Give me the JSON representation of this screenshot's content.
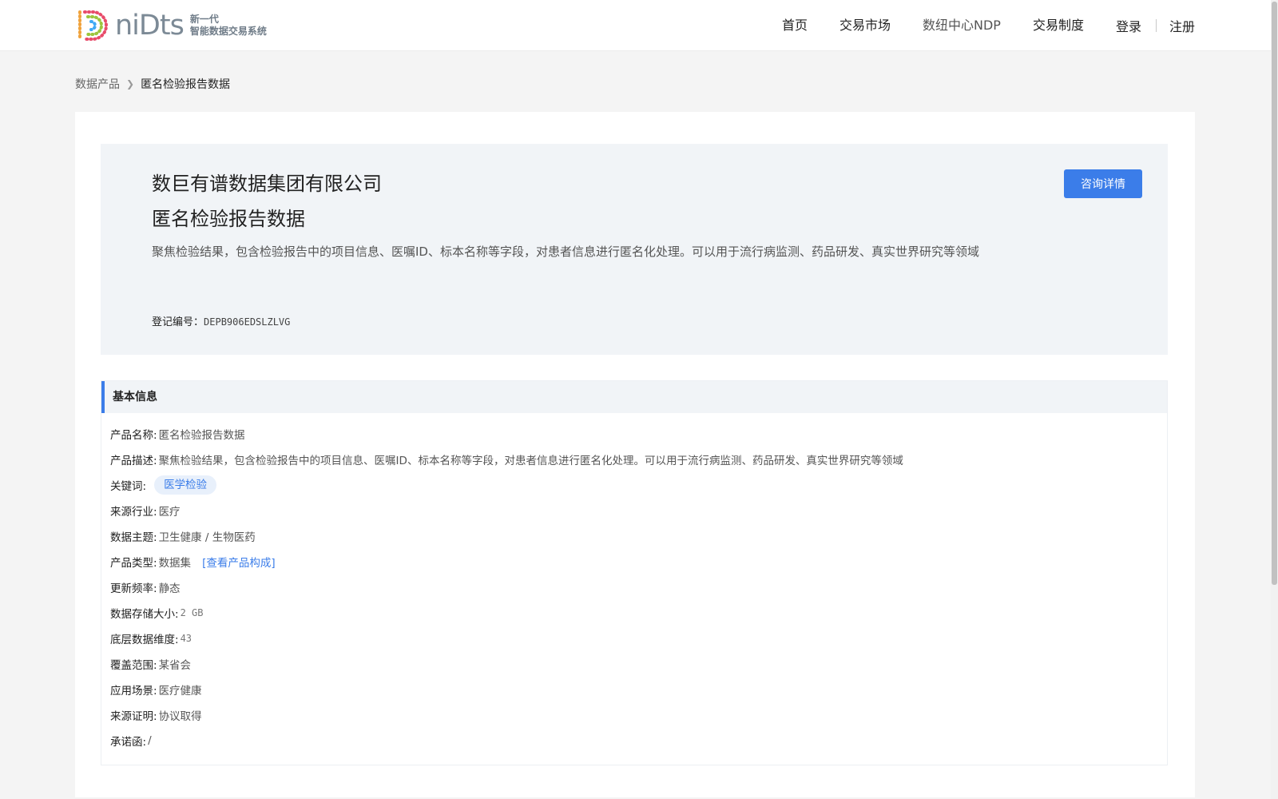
{
  "header": {
    "logo": {
      "word": "niDts",
      "tagline_1": "新一代",
      "tagline_2": "智能数据交易系统"
    },
    "nav": [
      "首页",
      "交易市场",
      "数纽中心NDP",
      "交易制度"
    ],
    "login": "登录",
    "register": "注册"
  },
  "breadcrumb": {
    "parent": "数据产品",
    "current": "匿名检验报告数据"
  },
  "hero": {
    "company": "数巨有谱数据集团有限公司",
    "title": "匿名检验报告数据",
    "description": "聚焦检验结果，包含检验报告中的项目信息、医嘱ID、标本名称等字段，对患者信息进行匿名化处理。可以用于流行病监测、药品研发、真实世界研究等领域",
    "reg_label": "登记编号：",
    "reg_value": "DEPB906EDSLZLVG",
    "consult_button": "咨询详情"
  },
  "basic_info": {
    "heading": "基本信息",
    "product_name": {
      "label": "产品名称:",
      "value": "匿名检验报告数据"
    },
    "product_desc": {
      "label": "产品描述:",
      "value": "聚焦检验结果，包含检验报告中的项目信息、医嘱ID、标本名称等字段，对患者信息进行匿名化处理。可以用于流行病监测、药品研发、真实世界研究等领域"
    },
    "keywords": {
      "label": "关键词:",
      "tag": "医学检验"
    },
    "industry": {
      "label": "来源行业:",
      "value": "医疗"
    },
    "theme": {
      "label": "数据主题:",
      "value": "卫生健康 / 生物医药"
    },
    "product_type": {
      "label": "产品类型:",
      "value": "数据集",
      "link": "[查看产品构成]"
    },
    "update_freq": {
      "label": "更新频率:",
      "value": "静态"
    },
    "storage": {
      "label": "数据存储大小:",
      "value": "2 GB"
    },
    "dimension": {
      "label": "底层数据维度:",
      "value": "43"
    },
    "coverage": {
      "label": "覆盖范围:",
      "value": "某省会"
    },
    "scenario": {
      "label": "应用场景:",
      "value": "医疗健康"
    },
    "source_proof": {
      "label": "来源证明:",
      "value": "协议取得"
    },
    "commitment": {
      "label": "承诺函:",
      "value": "/"
    }
  },
  "colors": {
    "accent": "#3b7de9",
    "hero_bg": "#f1f4f7",
    "page_bg": "#f4f4f4"
  }
}
